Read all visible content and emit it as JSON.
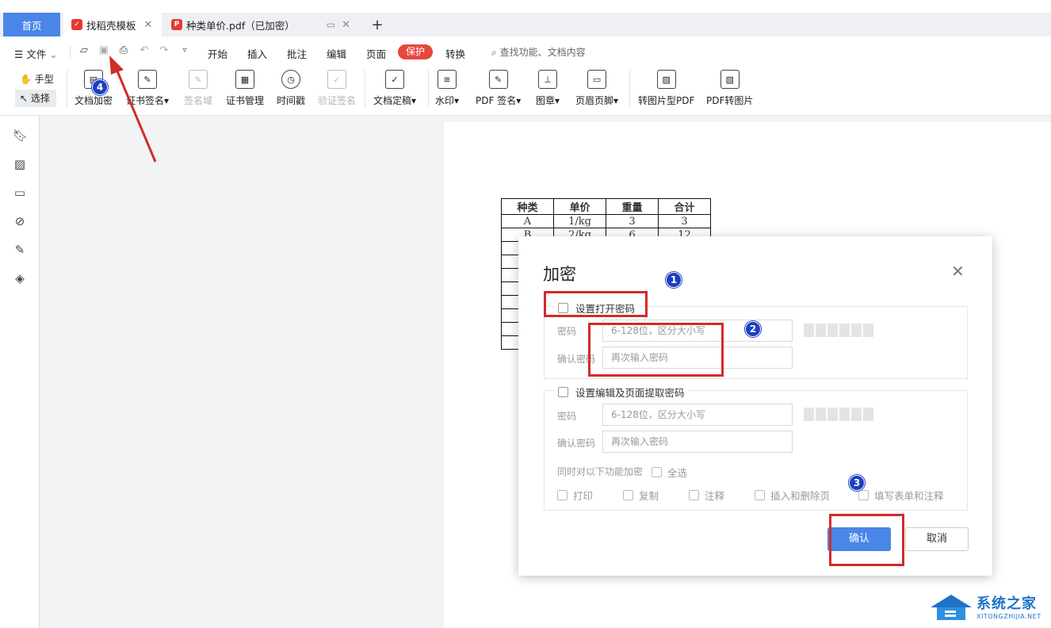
{
  "tabs": {
    "home": "首页",
    "template": "找稻壳模板",
    "pdf": "种类单价.pdf（已加密）",
    "close_glyph": "✕",
    "add_glyph": "+"
  },
  "menu": {
    "file": "文件",
    "items": [
      "开始",
      "插入",
      "批注",
      "编辑",
      "页面",
      "保护",
      "转换"
    ],
    "search": "查找功能、文档内容"
  },
  "tools": {
    "hand": "手型",
    "select": "选择"
  },
  "ribbon": [
    {
      "label": "文档加密",
      "icon": "doc-lock-icon",
      "disabled": false
    },
    {
      "label": "证书签名",
      "icon": "cert-sign-icon",
      "disabled": false,
      "dropdown": true
    },
    {
      "label": "签名域",
      "icon": "sign-field-icon",
      "disabled": true
    },
    {
      "label": "证书管理",
      "icon": "cert-manage-icon",
      "disabled": false
    },
    {
      "label": "时间戳",
      "icon": "timestamp-icon",
      "disabled": false
    },
    {
      "label": "验证签名",
      "icon": "verify-sign-icon",
      "disabled": true
    },
    {
      "label": "文档定稿",
      "icon": "finalize-icon",
      "disabled": false,
      "dropdown": true
    },
    {
      "label": "水印",
      "icon": "watermark-icon",
      "disabled": false,
      "dropdown": true
    },
    {
      "label": "PDF 签名",
      "icon": "pdf-sign-icon",
      "disabled": false,
      "dropdown": true
    },
    {
      "label": "图章",
      "icon": "stamp-icon",
      "disabled": false,
      "dropdown": true
    },
    {
      "label": "页眉页脚",
      "icon": "header-footer-icon",
      "disabled": false,
      "dropdown": true
    },
    {
      "label": "转图片型PDF",
      "icon": "to-image-pdf-icon",
      "disabled": false
    },
    {
      "label": "PDF转图片",
      "icon": "pdf-to-image-icon",
      "disabled": false
    }
  ],
  "doc_table": {
    "headers": [
      "种类",
      "单价",
      "重量",
      "合计"
    ],
    "rows": [
      [
        "A",
        "1/kg",
        "3",
        "3"
      ],
      [
        "B",
        "2/kg",
        "6",
        "12"
      ]
    ]
  },
  "dialog": {
    "title": "加密",
    "close_glyph": "✕",
    "open_password": {
      "checkbox_label": "设置打开密码",
      "password_label": "密码",
      "password_placeholder": "6-128位，区分大小写",
      "confirm_label": "确认密码",
      "confirm_placeholder": "再次输入密码"
    },
    "edit_password": {
      "checkbox_label": "设置编辑及页面提取密码",
      "password_label": "密码",
      "password_placeholder": "6-128位，区分大小写",
      "confirm_label": "确认密码",
      "confirm_placeholder": "再次输入密码",
      "encrypt_functions_label": "同时对以下功能加密",
      "select_all": "全选",
      "options": [
        "打印",
        "复制",
        "注释",
        "插入和删除页",
        "填写表单和注释"
      ]
    },
    "ok": "确认",
    "cancel": "取消"
  },
  "annotations": {
    "badges": [
      "1",
      "2",
      "3",
      "4"
    ],
    "arrow_color": "#d22b2b",
    "box_color": "#d22b2b"
  },
  "watermark": {
    "name": "系统之家",
    "url": "XITONGZHIJIA.NET"
  },
  "colors": {
    "accent": "#4a86e8",
    "protect_tab": "#e8473c"
  }
}
